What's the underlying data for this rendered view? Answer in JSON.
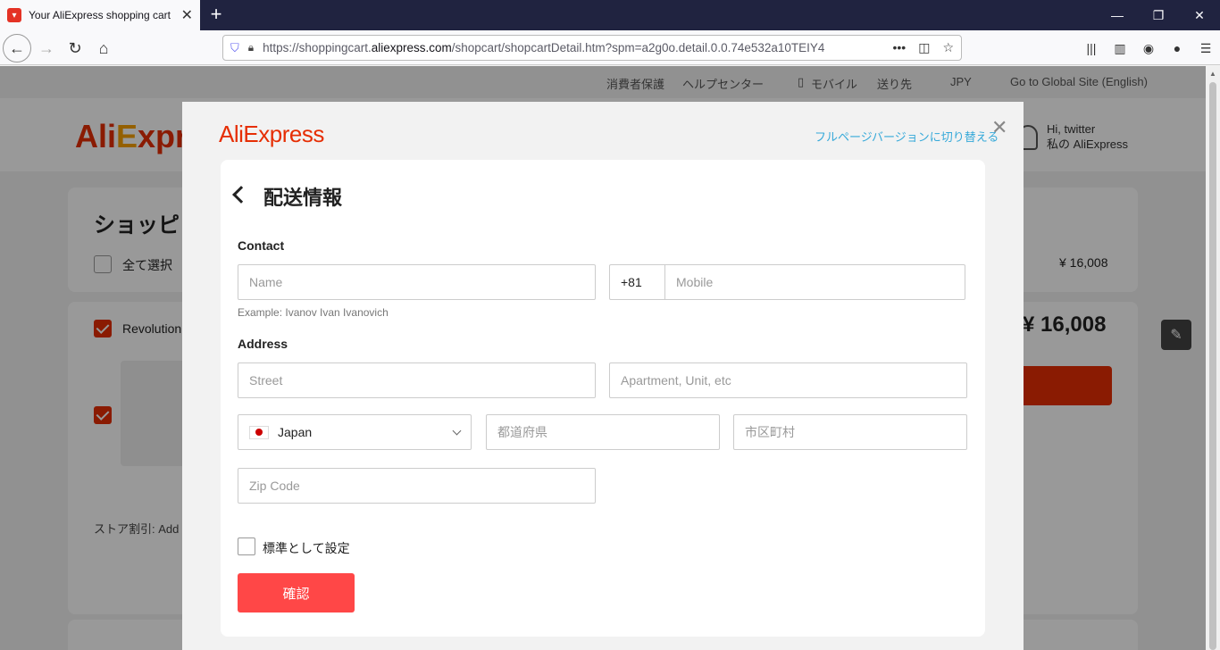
{
  "browser": {
    "tab_title": "Your AliExpress shopping cart -",
    "url_prefix": "https://shoppingcart.",
    "url_domain": "aliexpress.com",
    "url_suffix": "/shopcart/shopcartDetail.htm?spm=a2g0o.detail.0.0.74e532a10TEIY4"
  },
  "topbar": {
    "buyer_protection": "消費者保護",
    "help_center": "ヘルプセンター",
    "mobile": "モバイル",
    "ship_to": "送り先",
    "currency": "JPY",
    "global_site": "Go to Global Site (English)"
  },
  "header": {
    "user_greeting": "Hi, twitter",
    "my_account": "私の AliExpress"
  },
  "background": {
    "cart_title": "ショッピ",
    "select_all": "全て選択",
    "item_name": "Revolution",
    "subtotal": "¥ 16,008",
    "total": "¥ 16,008",
    "store_discount": "ストア割引: Add 2"
  },
  "modal": {
    "logo_ali": "Ali",
    "logo_express": "Express",
    "switch_link": "フルページバージョンに切り替える",
    "title": "配送情報",
    "contact_label": "Contact",
    "name_placeholder": "Name",
    "phone_prefix": "+81",
    "mobile_placeholder": "Mobile",
    "name_hint": "Example: Ivanov Ivan Ivanovich",
    "address_label": "Address",
    "street_placeholder": "Street",
    "apartment_placeholder": "Apartment, Unit, etc",
    "country": "Japan",
    "prefecture_placeholder": "都道府県",
    "city_placeholder": "市区町村",
    "zip_placeholder": "Zip Code",
    "default_label": "標準として設定",
    "confirm_label": "確認"
  }
}
